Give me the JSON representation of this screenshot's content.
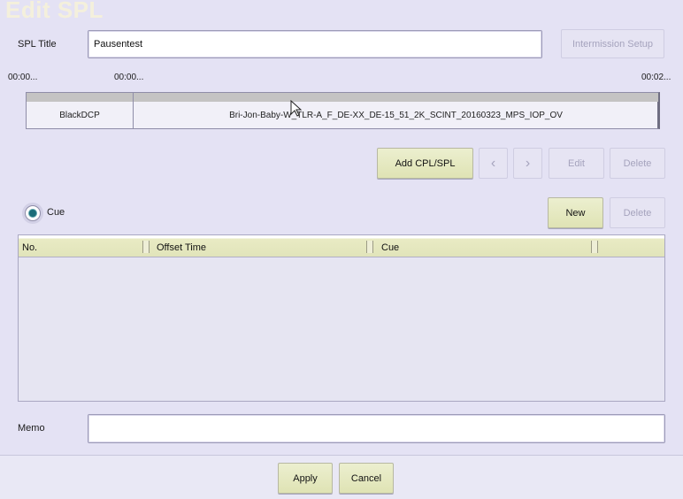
{
  "window": {
    "title": "Edit SPL"
  },
  "spl_title": {
    "label": "SPL Title",
    "value": "Pausentest"
  },
  "intermission_button": {
    "label": "Intermission Setup",
    "enabled": false
  },
  "timeline": {
    "time_start": "00:00...",
    "time_marker": "00:00...",
    "time_end": "00:02...",
    "segments": [
      {
        "label": "BlackDCP"
      },
      {
        "label": "Bri-Jon-Baby-W_TLR-A_F_DE-XX_DE-15_51_2K_SCINT_20160323_MPS_IOP_OV"
      }
    ]
  },
  "cpl_toolbar": {
    "add_label": "Add CPL/SPL",
    "prev_icon": "chevron-left-icon",
    "next_icon": "chevron-right-icon",
    "edit_label": "Edit",
    "delete_label": "Delete"
  },
  "cue_section": {
    "radio_label": "Cue",
    "radio_selected": true,
    "new_label": "New",
    "delete_label": "Delete",
    "columns": [
      "No.",
      "Offset Time",
      "Cue"
    ],
    "rows": []
  },
  "memo": {
    "label": "Memo",
    "value": ""
  },
  "footer": {
    "apply_label": "Apply",
    "cancel_label": "Cancel"
  },
  "colors": {
    "accent_button": "#e1e4ba",
    "background": "#e4e2f4",
    "radio_dot": "#1a6c78"
  }
}
